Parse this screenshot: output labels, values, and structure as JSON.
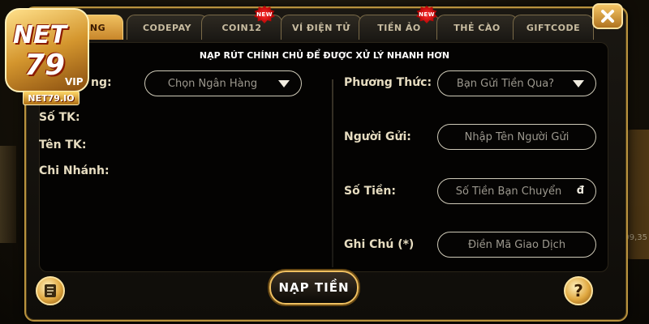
{
  "logo": {
    "brand": "NET",
    "number": "79",
    "tier": "VIP",
    "domain": "NET79.IO"
  },
  "tabs": [
    {
      "label": "NGÂN HÀNG",
      "display": "ÀNG",
      "active": true,
      "new": false
    },
    {
      "label": "CODEPAY",
      "active": false,
      "new": false
    },
    {
      "label": "COIN12",
      "active": false,
      "new": true
    },
    {
      "label": "VÍ ĐIỆN TỬ",
      "active": false,
      "new": false
    },
    {
      "label": "TIỀN ẢO",
      "active": false,
      "new": true
    },
    {
      "label": "THẺ CÀO",
      "active": false,
      "new": false
    },
    {
      "label": "GIFTCODE",
      "active": false,
      "new": false
    }
  ],
  "badge_text": "NEW",
  "notice": "NẠP RÚT CHÍNH CHỦ ĐỂ ĐƯỢC XỬ LÝ NHANH HƠN",
  "left": {
    "bank_label": "Ngân Hàng:",
    "bank_label_visible": "ng:",
    "bank_select": "Chọn Ngân Hàng",
    "account_no_label": "Số TK:",
    "account_name_label": "Tên TK:",
    "branch_label": "Chi Nhánh:"
  },
  "right": {
    "method_label": "Phương Thức:",
    "method_select": "Bạn Gửi Tiền Qua?",
    "sender_label": "Người Gửi:",
    "sender_placeholder": "Nhập Tên Người Gửi",
    "amount_label": "Số Tiền:",
    "amount_placeholder": "Số Tiền Bạn Chuyển",
    "currency": "đ",
    "note_label": "Ghi Chú (*)",
    "note_placeholder": "Điền Mã Giao Dịch"
  },
  "submit_label": "NẠP TIỀN",
  "help_label": "?",
  "background_text": "09,35",
  "colors": {
    "gold": "#f0c060",
    "frame": "#b8923e",
    "active_tab": "#c8862a"
  }
}
